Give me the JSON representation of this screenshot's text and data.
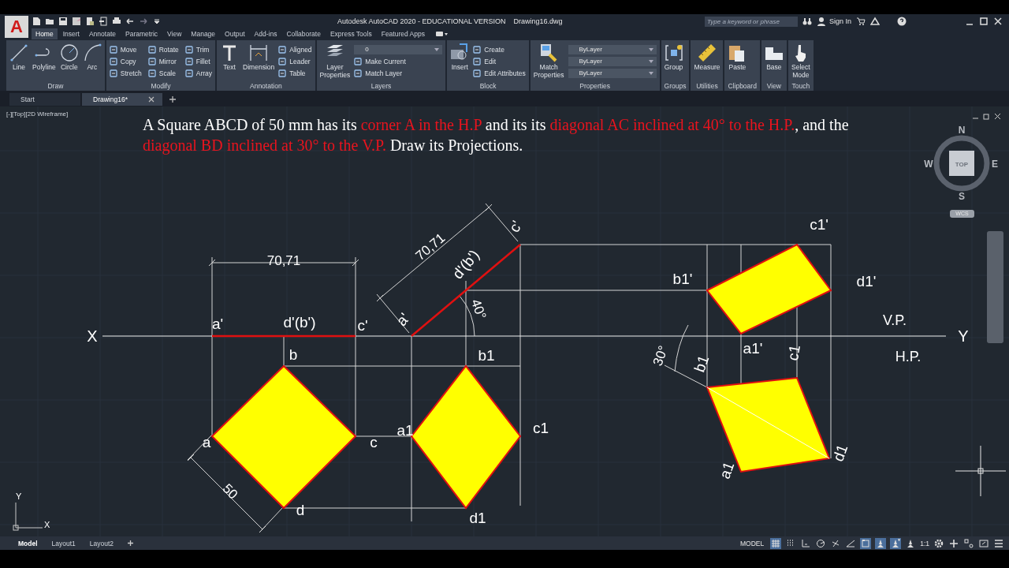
{
  "window": {
    "title": "Autodesk AutoCAD 2020 - EDUCATIONAL VERSION",
    "file": "Drawing16.dwg"
  },
  "app_button": {
    "label": "A"
  },
  "search": {
    "placeholder": "Type a keyword or phrase"
  },
  "account": {
    "label": "Sign In"
  },
  "ribbon": {
    "tabs": [
      {
        "label": "Home",
        "selected": true
      },
      {
        "label": "Insert",
        "selected": false
      },
      {
        "label": "Annotate",
        "selected": false
      },
      {
        "label": "Parametric",
        "selected": false
      },
      {
        "label": "View",
        "selected": false
      },
      {
        "label": "Manage",
        "selected": false
      },
      {
        "label": "Output",
        "selected": false
      },
      {
        "label": "Add-ins",
        "selected": false
      },
      {
        "label": "Collaborate",
        "selected": false
      },
      {
        "label": "Express Tools",
        "selected": false
      },
      {
        "label": "Featured Apps",
        "selected": false
      }
    ],
    "panels": [
      {
        "title": "Draw",
        "tools": [
          {
            "label": "Line",
            "kind": "large"
          },
          {
            "label": "Polyline",
            "kind": "large"
          },
          {
            "label": "Circle",
            "kind": "large"
          },
          {
            "label": "Arc",
            "kind": "large"
          }
        ]
      },
      {
        "title": "Modify",
        "tools": [
          {
            "label": "Move",
            "kind": "small"
          },
          {
            "label": "Copy",
            "kind": "small"
          },
          {
            "label": "Stretch",
            "kind": "small"
          },
          {
            "label": "Rotate",
            "kind": "small"
          },
          {
            "label": "Mirror",
            "kind": "small"
          },
          {
            "label": "Scale",
            "kind": "small"
          },
          {
            "label": "Trim",
            "kind": "small"
          },
          {
            "label": "Fillet",
            "kind": "small"
          },
          {
            "label": "Array",
            "kind": "small"
          }
        ]
      },
      {
        "title": "Annotation",
        "tools": [
          {
            "label": "Text",
            "kind": "large"
          },
          {
            "label": "Dimension",
            "kind": "large"
          },
          {
            "label": "Aligned",
            "kind": "small"
          },
          {
            "label": "Leader",
            "kind": "small"
          },
          {
            "label": "Table",
            "kind": "small"
          }
        ]
      },
      {
        "title": "Layers",
        "tools": [
          {
            "label": "Layer Properties",
            "kind": "large"
          },
          {
            "value": "0",
            "kind": "dropdown"
          },
          {
            "label": "Make Current",
            "kind": "small"
          },
          {
            "label": "Match Layer",
            "kind": "small"
          }
        ]
      },
      {
        "title": "Block",
        "tools": [
          {
            "label": "Insert",
            "kind": "large"
          },
          {
            "label": "Create",
            "kind": "small"
          },
          {
            "label": "Edit",
            "kind": "small"
          },
          {
            "label": "Edit Attributes",
            "kind": "small"
          }
        ]
      },
      {
        "title": "Properties",
        "tools": [
          {
            "label": "Match Properties",
            "kind": "large"
          },
          {
            "value": "ByLayer",
            "kind": "dropdown"
          },
          {
            "value": "ByLayer",
            "kind": "dropdown"
          },
          {
            "value": "ByLayer",
            "kind": "dropdown"
          }
        ]
      },
      {
        "title": "Groups",
        "tools": [
          {
            "label": "Group",
            "kind": "large"
          }
        ]
      },
      {
        "title": "Utilities",
        "tools": [
          {
            "label": "Measure",
            "kind": "large"
          }
        ]
      },
      {
        "title": "Clipboard",
        "tools": [
          {
            "label": "Paste",
            "kind": "large"
          }
        ]
      },
      {
        "title": "View",
        "tools": [
          {
            "label": "Base",
            "kind": "large"
          }
        ]
      },
      {
        "title": "Touch",
        "tools": [
          {
            "label": "Select Mode",
            "kind": "large"
          }
        ]
      }
    ]
  },
  "document_tabs": [
    {
      "label": "Start",
      "selected": false
    },
    {
      "label": "Drawing16*",
      "selected": true
    }
  ],
  "viewport": {
    "label": "[-][Top][2D Wireframe]",
    "problem": [
      {
        "text": "A Square ABCD of 50 mm has its ",
        "highlight": false
      },
      {
        "text": "corner A in the H.P",
        "highlight": true
      },
      {
        "text": " and its its ",
        "highlight": false
      },
      {
        "text": "diagonal AC  inclined at 40° to the H.P.",
        "highlight": true
      },
      {
        "text": ", and the ",
        "highlight": false
      },
      {
        "text": "diagonal BD inclined at 30° to the V.P.",
        "highlight": true
      },
      {
        "text": " Draw its Projections.",
        "highlight": false
      }
    ],
    "labels": [
      {
        "text": "X",
        "kind": "axis"
      },
      {
        "text": "Y",
        "kind": "axis"
      },
      {
        "text": "V.P.",
        "kind": "plane"
      },
      {
        "text": "H.P.",
        "kind": "plane"
      },
      {
        "text": "70,71",
        "kind": "dimension"
      },
      {
        "text": "a'",
        "kind": "point"
      },
      {
        "text": "d'(b')",
        "kind": "point"
      },
      {
        "text": "c'",
        "kind": "point"
      },
      {
        "text": "b",
        "kind": "point"
      },
      {
        "text": "a",
        "kind": "point"
      },
      {
        "text": "c",
        "kind": "point"
      },
      {
        "text": "d",
        "kind": "point"
      },
      {
        "text": "50",
        "kind": "dimension"
      },
      {
        "text": "70,71",
        "kind": "dimension"
      },
      {
        "text": "c'",
        "kind": "point"
      },
      {
        "text": "d'(b')",
        "kind": "point"
      },
      {
        "text": "a'",
        "kind": "point"
      },
      {
        "text": "40°",
        "kind": "dimension"
      },
      {
        "text": "b1",
        "kind": "point"
      },
      {
        "text": "a1",
        "kind": "point"
      },
      {
        "text": "c1",
        "kind": "point"
      },
      {
        "text": "d1",
        "kind": "point"
      },
      {
        "text": "b1'",
        "kind": "point"
      },
      {
        "text": "c1'",
        "kind": "point"
      },
      {
        "text": "d1'",
        "kind": "point"
      },
      {
        "text": "a1'",
        "kind": "point"
      },
      {
        "text": "30°",
        "kind": "dimension"
      },
      {
        "text": "b1",
        "kind": "point"
      },
      {
        "text": "c1",
        "kind": "point"
      },
      {
        "text": "d1",
        "kind": "point"
      },
      {
        "text": "a1",
        "kind": "point"
      }
    ],
    "viewcube": {
      "north": "N",
      "west": "W",
      "east": "E",
      "south": "S",
      "face": "TOP",
      "ucs": "WCS"
    },
    "ucs_icon": {
      "y": "Y",
      "x": "X"
    }
  },
  "layout_tabs": [
    {
      "label": "Model",
      "selected": true
    },
    {
      "label": "Layout1",
      "selected": false
    },
    {
      "label": "Layout2",
      "selected": false
    }
  ],
  "status_bar": {
    "mode": "MODEL",
    "scale": "1:1",
    "toggles": [
      {
        "kind": "grid",
        "on": true
      },
      {
        "kind": "snap",
        "on": false
      },
      {
        "kind": "ortho",
        "on": false
      },
      {
        "kind": "polar",
        "on": false
      },
      {
        "kind": "osnap",
        "on": false
      },
      {
        "kind": "angle",
        "on": false
      },
      {
        "kind": "selection",
        "on": true
      },
      {
        "kind": "annovis",
        "on": true
      },
      {
        "kind": "autoscale",
        "on": true
      },
      {
        "kind": "monitor",
        "on": false
      }
    ]
  }
}
